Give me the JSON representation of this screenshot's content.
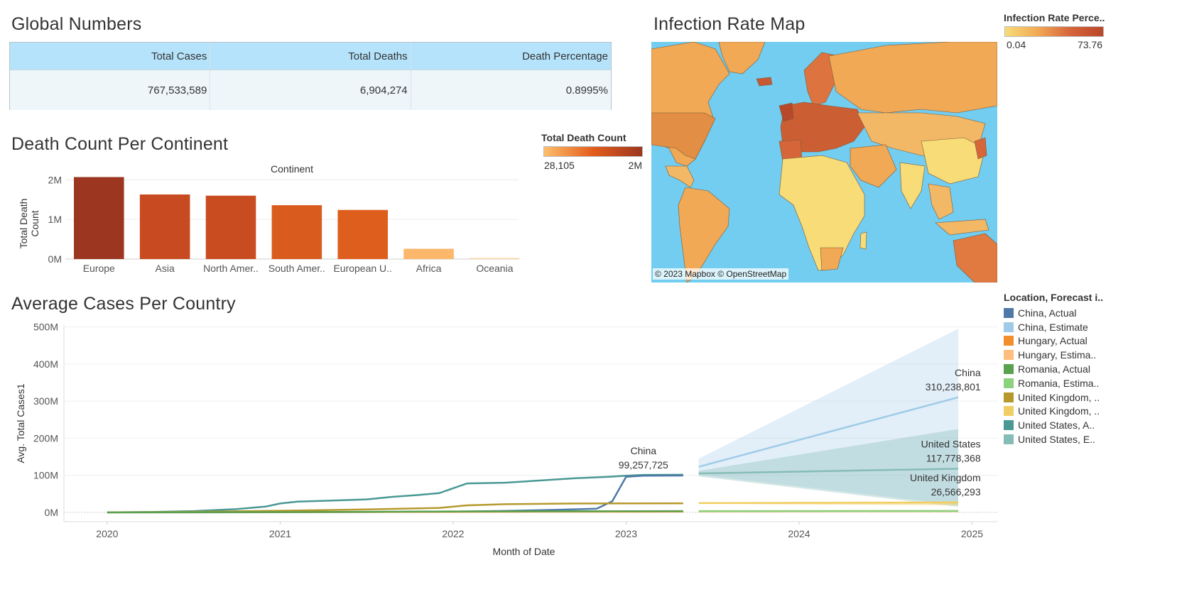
{
  "global_numbers": {
    "title": "Global Numbers",
    "columns": [
      "Total Cases",
      "Total Deaths",
      "Death Percentage"
    ],
    "values": [
      "767,533,589",
      "6,904,274",
      "0.8995%"
    ]
  },
  "infection_map": {
    "title": "Infection Rate Map",
    "legend_title": "Infection Rate Perce..",
    "legend_min": "0.04",
    "legend_max": "73.76",
    "credit": "© 2023 Mapbox © OpenStreetMap",
    "colors": {
      "ocean": "#72cdf0",
      "low": "#f7dc77",
      "mid": "#f1a955",
      "high": "#d6653a",
      "max": "#b9472a"
    }
  },
  "death_legend": {
    "title": "Total Death Count",
    "min": "28,105",
    "max": "2M",
    "colors": [
      "#fdbf6a",
      "#e35d1c",
      "#9c3620"
    ]
  },
  "chart_data": [
    {
      "type": "bar",
      "title": "Death Count Per Continent",
      "header": "Continent",
      "ylabel": "Total Death Count",
      "categories": [
        "Europe",
        "Asia",
        "North Amer..",
        "South Amer..",
        "European U..",
        "Africa",
        "Oceania"
      ],
      "values": [
        2070000,
        1630000,
        1600000,
        1360000,
        1240000,
        259000,
        28105
      ],
      "yticks": [
        {
          "v": 0,
          "label": "0M"
        },
        {
          "v": 1000000,
          "label": "1M"
        },
        {
          "v": 2000000,
          "label": "2M"
        }
      ],
      "ylim": [
        0,
        2150000
      ],
      "colors": [
        "#9c3620",
        "#c74a20",
        "#c94c20",
        "#d95b1e",
        "#de5f1d",
        "#fbb76a",
        "#fdd6a8"
      ]
    },
    {
      "type": "line",
      "title": "Average Cases Per Country",
      "xlabel": "Month of Date",
      "ylabel": "Avg. Total Cases1",
      "xticks": [
        2020,
        2021,
        2022,
        2023,
        2024,
        2025
      ],
      "yticks": [
        {
          "v": 0,
          "label": "0M"
        },
        {
          "v": 100000000,
          "label": "100M"
        },
        {
          "v": 200000000,
          "label": "200M"
        },
        {
          "v": 300000000,
          "label": "300M"
        },
        {
          "v": 400000000,
          "label": "400M"
        },
        {
          "v": 500000000,
          "label": "500M"
        }
      ],
      "xlim": [
        2019.75,
        2025.15
      ],
      "ylim": [
        -25000000,
        505000000
      ],
      "legend_title": "Location, Forecast i..",
      "legend": [
        {
          "label": "China, Actual",
          "color": "#4e79a7"
        },
        {
          "label": "China, Estimate",
          "color": "#a0cbe8"
        },
        {
          "label": "Hungary, Actual",
          "color": "#f28e2b"
        },
        {
          "label": "Hungary, Estima..",
          "color": "#ffbe7d"
        },
        {
          "label": "Romania, Actual",
          "color": "#59a14f"
        },
        {
          "label": "Romania, Estima..",
          "color": "#8cd17d"
        },
        {
          "label": "United Kingdom, ..",
          "color": "#b6992d"
        },
        {
          "label": "United Kingdom, ..",
          "color": "#f1ce63"
        },
        {
          "label": "United States, A..",
          "color": "#499894"
        },
        {
          "label": "United States, E..",
          "color": "#86bcb6"
        }
      ],
      "series": [
        {
          "color": "#499894",
          "width": 2.5,
          "x": [
            2020,
            2020.25,
            2020.5,
            2020.75,
            2020.92,
            2021,
            2021.1,
            2021.3,
            2021.5,
            2021.65,
            2021.8,
            2021.92,
            2022.08,
            2022.3,
            2022.5,
            2022.7,
            2022.9,
            2023,
            2023.1,
            2023.33
          ],
          "y": [
            0,
            1000000,
            3500000,
            9000000,
            16000000,
            24000000,
            29000000,
            32000000,
            35000000,
            42000000,
            47000000,
            52000000,
            78000000,
            80000000,
            86000000,
            92000000,
            96000000,
            99000000,
            101000000,
            101500000
          ]
        },
        {
          "color": "#4e79a7",
          "width": 2.5,
          "x": [
            2020,
            2020.5,
            2021,
            2021.5,
            2022,
            2022.3,
            2022.6,
            2022.83,
            2022.92,
            2023,
            2023.1,
            2023.33
          ],
          "y": [
            0,
            200000,
            500000,
            1000000,
            2000000,
            4000000,
            7000000,
            10000000,
            30000000,
            96000000,
            99000000,
            99257725
          ]
        },
        {
          "color": "#b6992d",
          "width": 2.5,
          "x": [
            2020,
            2020.5,
            2021,
            2021.5,
            2021.92,
            2022.08,
            2022.3,
            2022.7,
            2023,
            2023.33
          ],
          "y": [
            0,
            1500000,
            4500000,
            8000000,
            12000000,
            19000000,
            22000000,
            24000000,
            24300000,
            24400000
          ]
        },
        {
          "color": "#f28e2b",
          "width": 2.5,
          "x": [
            2020,
            2021,
            2022,
            2022.5,
            2023.33
          ],
          "y": [
            0,
            500000,
            1500000,
            2000000,
            2200000
          ]
        },
        {
          "color": "#59a14f",
          "width": 2.5,
          "x": [
            2020,
            2021,
            2022,
            2022.5,
            2023.33
          ],
          "y": [
            0,
            800000,
            2500000,
            3000000,
            3400000
          ]
        },
        {
          "color": "#a0cbe8",
          "width": 2.5,
          "x": [
            2023.42,
            2024.92
          ],
          "y": [
            123000000,
            310238801
          ]
        },
        {
          "color": "#86bcb6",
          "width": 2.5,
          "x": [
            2023.42,
            2024.92
          ],
          "y": [
            105000000,
            117778368
          ]
        },
        {
          "color": "#f1ce63",
          "width": 2.5,
          "x": [
            2023.42,
            2024.92
          ],
          "y": [
            25000000,
            26566293
          ]
        },
        {
          "color": "#ffbe7d",
          "width": 2.5,
          "x": [
            2023.42,
            2024.92
          ],
          "y": [
            2400000,
            3000000
          ]
        },
        {
          "color": "#8cd17d",
          "width": 2.5,
          "x": [
            2023.42,
            2024.92
          ],
          "y": [
            3500000,
            4000000
          ]
        }
      ],
      "bands": [
        {
          "color": "#a0cbe8",
          "opacity": 0.3,
          "x": [
            2023.42,
            2024.92
          ],
          "upper": [
            145000000,
            495000000
          ],
          "lower": [
            101000000,
            20000000
          ]
        },
        {
          "color": "#86bcb6",
          "opacity": 0.35,
          "x": [
            2023.42,
            2024.92
          ],
          "upper": [
            112000000,
            225000000
          ],
          "lower": [
            97000000,
            15000000
          ]
        },
        {
          "color": "#f1ce63",
          "opacity": 0.45,
          "x": [
            2023.42,
            2024.92
          ],
          "upper": [
            27000000,
            30000000
          ],
          "lower": [
            23000000,
            19000000
          ]
        }
      ],
      "annotations": [
        {
          "x": 2023.1,
          "y": 99257725,
          "name": "China",
          "value": "99,257,725",
          "anchor": "middle"
        },
        {
          "x": 2025.05,
          "y": 310238801,
          "name": "China",
          "value": "310,238,801",
          "anchor": "end"
        },
        {
          "x": 2025.05,
          "y": 117778368,
          "name": "United States",
          "value": "117,778,368",
          "anchor": "end"
        },
        {
          "x": 2025.05,
          "y": 26566293,
          "name": "United Kingdom",
          "value": "26,566,293",
          "anchor": "end"
        }
      ]
    }
  ]
}
